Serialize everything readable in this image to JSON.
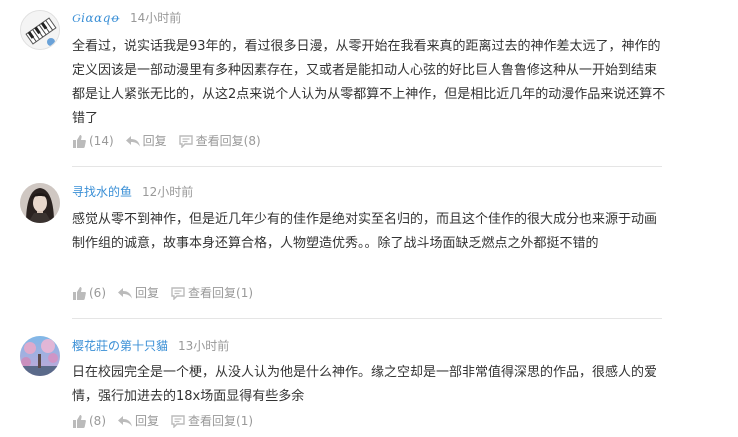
{
  "comments": [
    {
      "username": "Ԍiɑɑqꝋ",
      "time": "14小时前",
      "text": "全看过，说实话我是93年的，看过很多日漫，从零开始在我看来真的距离过去的神作差太远了，神作的定义因该是一部动漫里有多种因素存在，又或者是能扣动人心弦的好比巨人鲁鲁修这种从一开始到结束都是让人紧张无比的，从这2点来说个人认为从零都算不上神作，但是相比近几年的动漫作品来说还算不错了",
      "likes": "(14)",
      "reply_label": "回复",
      "view_replies": "查看回复(8)"
    },
    {
      "username": "寻找水的鱼",
      "time": "12小时前",
      "text": "感觉从零不到神作，但是近几年少有的佳作是绝对实至名归的，而且这个佳作的很大成分也来源于动画制作组的诚意，故事本身还算合格，人物塑造优秀。。除了战斗场面缺乏燃点之外都挺不错的",
      "likes": "(6)",
      "reply_label": "回复",
      "view_replies": "查看回复(1)"
    },
    {
      "username": "樱花莊の第十只貓",
      "time": "13小时前",
      "text": "日在校园完全是一个梗，从没人认为他是什么神作。缘之空却是一部非常值得深思的作品，很感人的爱情，强行加进去的18x场面显得有些多余",
      "likes": "(8)",
      "reply_label": "回复",
      "view_replies": "查看回复(1)"
    }
  ],
  "icons": {
    "like": "thumbs-up-icon",
    "reply": "reply-arrow-icon",
    "view": "comment-bubble-icon"
  },
  "colors": {
    "username": "#3a8fd6",
    "time": "#999999",
    "text": "#333333",
    "icon": "#bbbbbb",
    "divider": "#e5e5e5"
  }
}
